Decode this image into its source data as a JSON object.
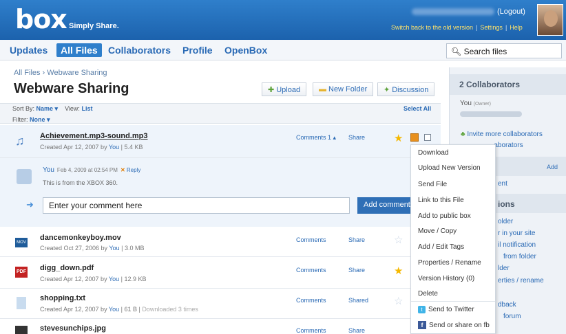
{
  "header": {
    "logo": "box",
    "tagline": "Simply Share.",
    "logout": "(Logout)",
    "links": [
      "Switch back to the old version",
      "Settings",
      "Help"
    ]
  },
  "nav": {
    "tabs": [
      "Updates",
      "All Files",
      "Collaborators",
      "Profile",
      "OpenBox"
    ],
    "active": "All Files",
    "search_placeholder": "Search files"
  },
  "main": {
    "breadcrumb": "All Files › Webware Sharing",
    "title": "Webware Sharing",
    "buttons": {
      "upload": "Upload",
      "new_folder": "New Folder",
      "discussion": "Discussion"
    },
    "sort_by_label": "Sort By:",
    "sort_by_value": "Name ▾",
    "view_label": "View:",
    "view_value": "List",
    "select_all": "Select All",
    "filter_label": "Filter:",
    "filter_value": "None ▾"
  },
  "files": [
    {
      "name": "Achievement.mp3-sound.mp3",
      "created": "Created Apr 12, 2007 by",
      "by": "You",
      "size": "5.4 KB",
      "comments": "Comments 1 ▴",
      "share": "Share",
      "starred": true
    },
    {
      "name": "dancemonkeyboy.mov",
      "created": "Created Oct 27, 2006 by",
      "by": "You",
      "size": "3.0 MB",
      "comments": "Comments",
      "share": "Share",
      "starred": false
    },
    {
      "name": "digg_down.pdf",
      "created": "Created Apr 12, 2007 by",
      "by": "You",
      "size": "12.9 KB",
      "comments": "Comments",
      "share": "Share",
      "starred": true
    },
    {
      "name": "shopping.txt",
      "created": "Created Apr 12, 2007 by",
      "by": "You",
      "size": "61 B",
      "extra": "Downloaded 3 times",
      "comments": "Comments",
      "share": "Shared",
      "starred": false
    },
    {
      "name": "stevesunchips.jpg",
      "comments": "Comments",
      "share": "Share"
    }
  ],
  "comment": {
    "user": "You",
    "time": "Feb 4, 2009 at 02:54 PM",
    "reply": "Reply",
    "text": "This is from the XBOX 360.",
    "input_value": "Enter your comment here",
    "add_button": "Add comment"
  },
  "context_menu": [
    "Download",
    "Upload New Version",
    "Send File",
    "Link to this File",
    "Add to public box",
    "Move / Copy",
    "Add / Edit Tags",
    "Properties / Rename",
    "Version History (0)",
    "Delete",
    "Send to Twitter",
    "Send or share on fb"
  ],
  "sidebar": {
    "collab_header": "2 Collaborators",
    "you_label": "You",
    "you_note": "(Owner)",
    "links": [
      "Invite more collaborators",
      "...aborators"
    ],
    "add": "Add",
    "ent": "ent",
    "ions_header": "ions",
    "partial_items": [
      "older",
      "r in your site",
      "il notification",
      "from folder",
      "lder",
      "erties / rename"
    ],
    "bottom_items": [
      "dback",
      "forum"
    ]
  }
}
